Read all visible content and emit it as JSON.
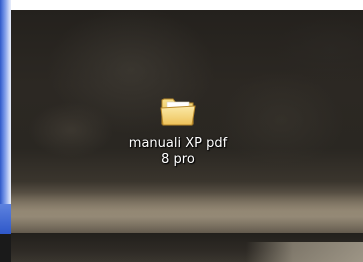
{
  "desktop": {
    "icons": [
      {
        "icon": "folder-icon",
        "label_line1": "manuali XP pdf",
        "label_line2": "8 pro"
      }
    ]
  },
  "colors": {
    "window_border": "#2f58c9",
    "label_text": "#ffffff",
    "folder_fill": "#f4d372"
  }
}
